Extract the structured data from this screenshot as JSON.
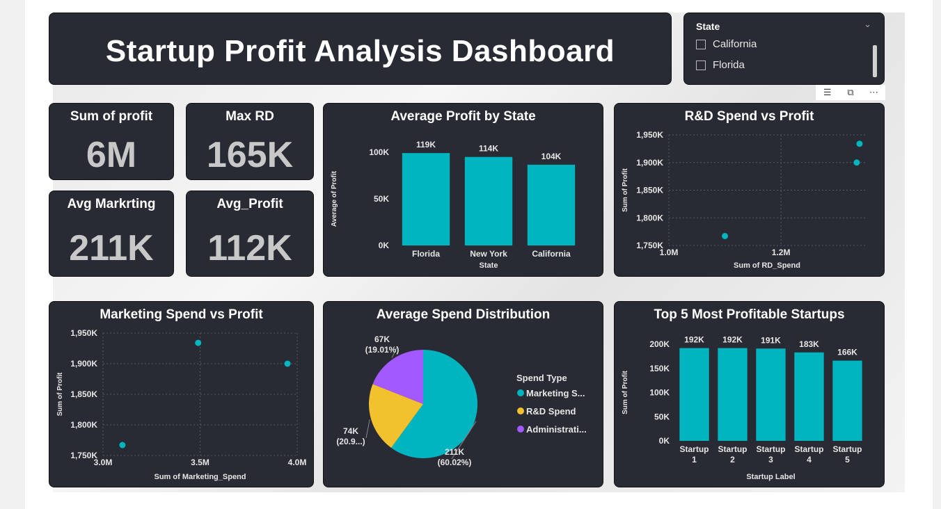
{
  "header": {
    "title": "Startup Profit Analysis Dashboard"
  },
  "slicer": {
    "title": "State",
    "items": [
      "California",
      "Florida"
    ]
  },
  "kpis": [
    {
      "title": "Sum of profit",
      "value": "6M"
    },
    {
      "title": "Max RD",
      "value": "165K"
    },
    {
      "title": "Avg Markrting",
      "value": "211K"
    },
    {
      "title": "Avg_Profit",
      "value": "112K"
    }
  ],
  "colors": {
    "teal": "#00b4c0",
    "yellow": "#f2c12e",
    "purple": "#a259ff",
    "card": "#282b33"
  },
  "chart_data": [
    {
      "type": "bar",
      "title": "Average Profit by State",
      "xlabel": "State",
      "ylabel": "Average of Profit",
      "categories": [
        "Florida",
        "New York",
        "California"
      ],
      "values": [
        119000,
        114000,
        104000
      ],
      "data_labels": [
        "119K",
        "114K",
        "104K"
      ],
      "yticks": [
        "0K",
        "50K",
        "100K"
      ],
      "ylim": [
        0,
        120000
      ]
    },
    {
      "type": "scatter",
      "title": "R&D Spend vs Profit",
      "xlabel": "Sum of RD_Spend",
      "ylabel": "Sum of Profit",
      "x": [
        1100000,
        1340000,
        1335000
      ],
      "y": [
        1767000,
        1934000,
        1900000
      ],
      "xticks": [
        "1.0M",
        "1.2M"
      ],
      "yticks": [
        "1,750K",
        "1,800K",
        "1,850K",
        "1,900K",
        "1,950K"
      ],
      "xlim": [
        1000000,
        1350000
      ],
      "ylim": [
        1750000,
        1950000
      ]
    },
    {
      "type": "scatter",
      "title": "Marketing Spend vs Profit",
      "xlabel": "Sum of Marketing_Spend",
      "ylabel": "Sum of Profit",
      "x": [
        3100000,
        3490000,
        3950000
      ],
      "y": [
        1767000,
        1934000,
        1900000
      ],
      "xticks": [
        "3.0M",
        "3.5M",
        "4.0M"
      ],
      "yticks": [
        "1,750K",
        "1,800K",
        "1,850K",
        "1,900K",
        "1,950K"
      ],
      "xlim": [
        3000000,
        4000000
      ],
      "ylim": [
        1750000,
        1950000
      ]
    },
    {
      "type": "pie",
      "title": "Average Spend Distribution",
      "legend_title": "Spend Type",
      "labels": [
        "Marketing S...",
        "R&D Spend",
        "Administrati..."
      ],
      "values": [
        60.02,
        20.97,
        19.01
      ],
      "data_labels": [
        [
          "211K",
          "(60.02%)"
        ],
        [
          "74K",
          "(20.9...)"
        ],
        [
          "67K",
          "(19.01%)"
        ]
      ]
    },
    {
      "type": "bar",
      "title": "Top 5 Most Profitable Startups",
      "xlabel": "Startup Label",
      "ylabel": "Sum of Profit",
      "categories": [
        [
          "Startup",
          "1"
        ],
        [
          "Startup",
          "2"
        ],
        [
          "Startup",
          "3"
        ],
        [
          "Startup",
          "4"
        ],
        [
          "Startup",
          "5"
        ]
      ],
      "values": [
        192000,
        192000,
        191000,
        183000,
        166000
      ],
      "data_labels": [
        "192K",
        "192K",
        "191K",
        "183K",
        "166K"
      ],
      "yticks": [
        "0K",
        "50K",
        "100K",
        "150K",
        "200K"
      ],
      "ylim": [
        0,
        200000
      ]
    }
  ]
}
